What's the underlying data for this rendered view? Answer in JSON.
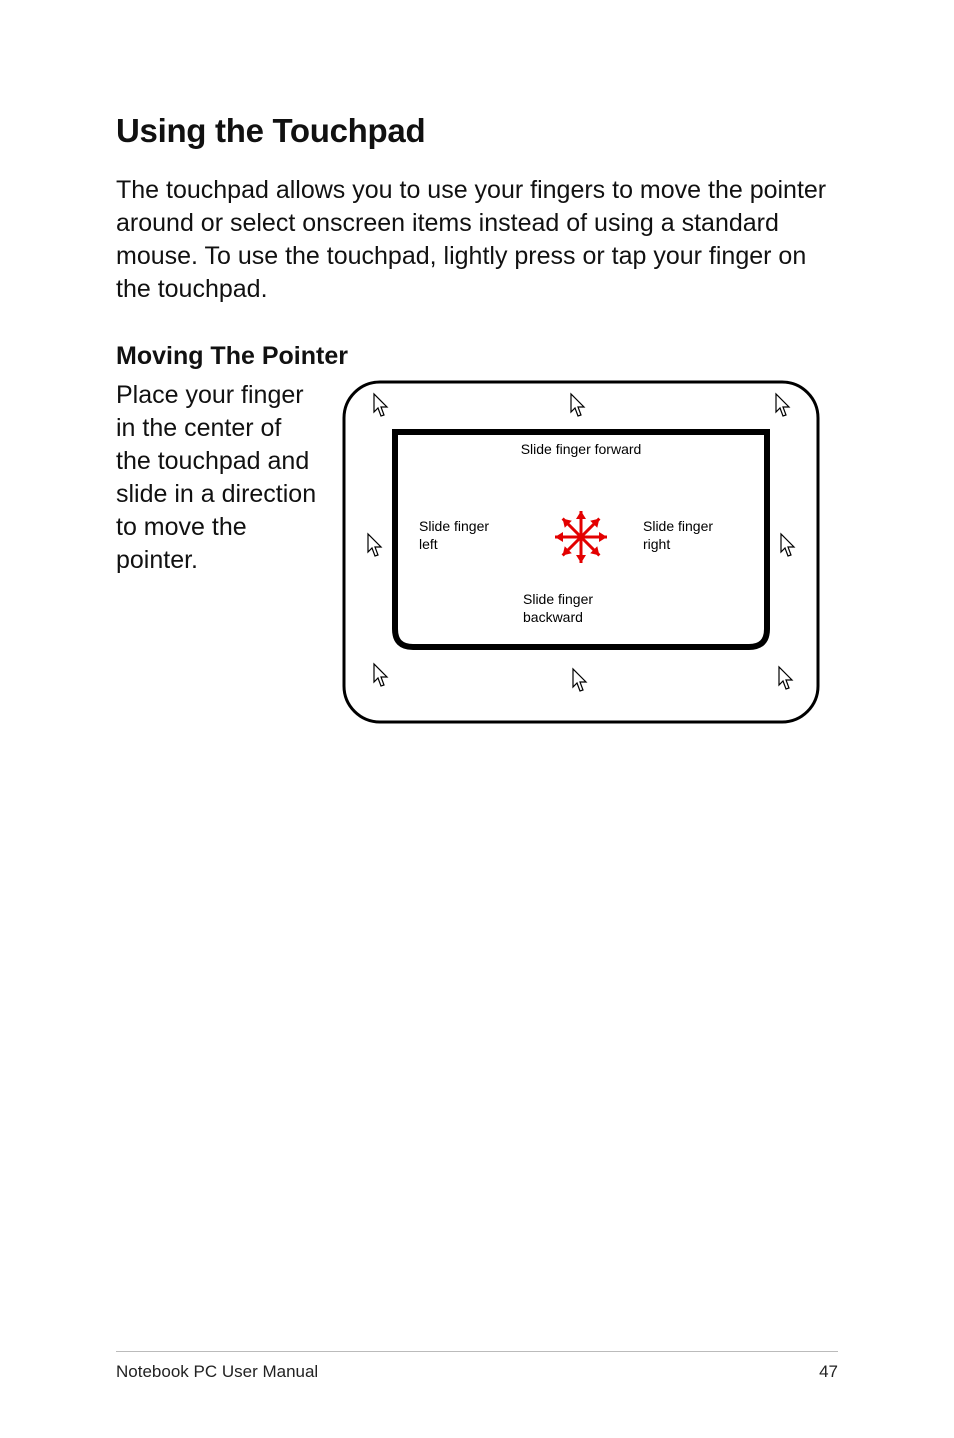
{
  "heading": "Using the Touchpad",
  "intro": "The touchpad allows you to use your fingers to move the pointer around or select onscreen items instead of using a standard mouse. To use the touchpad, lightly press or tap your finger on the touchpad.",
  "subheading": "Moving The Pointer",
  "pointer_text": "Place your finger in the center of the touchpad and slide in a direction to move the pointer.",
  "diagram": {
    "forward": "Slide finger forward",
    "left1": "Slide finger",
    "left2": "left",
    "right1": "Slide finger",
    "right2": "right",
    "back1": "Slide finger",
    "back2": "backward"
  },
  "footer_left": "Notebook PC User Manual",
  "footer_right": "47"
}
